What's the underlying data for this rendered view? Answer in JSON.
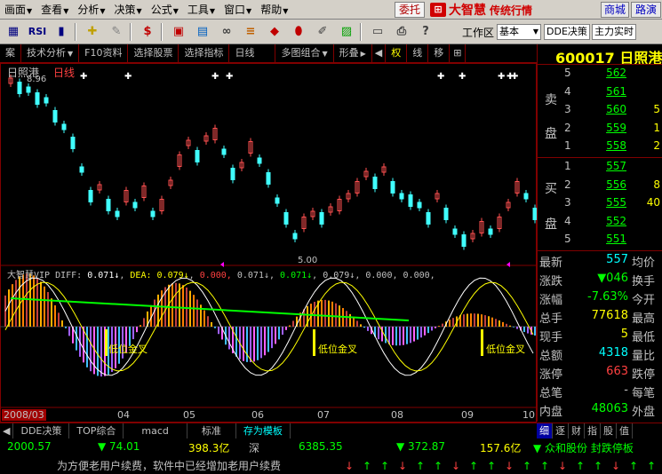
{
  "menu": [
    "画面",
    "查看",
    "分析",
    "决策",
    "公式",
    "工具",
    "窗口",
    "帮助"
  ],
  "weituo": "委托",
  "brand": {
    "name": "大智慧",
    "slogan": "传统行情"
  },
  "mall": "商城",
  "route": "路演",
  "toolbar": {
    "rsi": "RSI",
    "workzone_label": "工作区",
    "workzone_value": "基本",
    "combo_dde": "DDE决策",
    "combo_main": "主力实时"
  },
  "tabs": [
    "案",
    "技术分析",
    "F10资料",
    "选择股票",
    "选择指标",
    "日线",
    "多图组合",
    "形叠",
    "权",
    "线",
    "移"
  ],
  "chart": {
    "stock_name": "日照港",
    "period": "日线",
    "price_high": "8.96",
    "price_low": "5.00",
    "indicator": {
      "name": "大智慧VIP",
      "diff_label": "DIFF:",
      "diff_value": "0.071↓",
      "dea_label": "DEA:",
      "dea_value": "0.079↓",
      "v1": "0.000,",
      "v2": "0.071↓",
      "v3": "0.071↓",
      "v4": "0.079↓",
      "v5": "0.000,",
      "v6": "0.000,"
    },
    "gold_label": "低位金叉",
    "year": "2008/03",
    "months": [
      "04",
      "05",
      "06",
      "07",
      "08",
      "09",
      "10"
    ]
  },
  "quote": {
    "code": "600017",
    "name": "日照港",
    "sell_label_1": "卖",
    "sell_label_2": "盘",
    "buy_label_1": "买",
    "buy_label_2": "盘",
    "asks": [
      {
        "level": "5",
        "price": "562",
        "vol": ""
      },
      {
        "level": "4",
        "price": "561",
        "vol": ""
      },
      {
        "level": "3",
        "price": "560",
        "vol": "5"
      },
      {
        "level": "2",
        "price": "559",
        "vol": "1"
      },
      {
        "level": "1",
        "price": "558",
        "vol": "2"
      }
    ],
    "bids": [
      {
        "level": "1",
        "price": "557",
        "vol": ""
      },
      {
        "level": "2",
        "price": "556",
        "vol": "8"
      },
      {
        "level": "3",
        "price": "555",
        "vol": "40"
      },
      {
        "level": "4",
        "price": "552",
        "vol": ""
      },
      {
        "level": "5",
        "price": "551",
        "vol": ""
      }
    ],
    "stats": [
      {
        "label": "最新",
        "value": "557",
        "label2": "均价",
        "color": "#00ffff"
      },
      {
        "label": "涨跌",
        "value": "▼046",
        "label2": "换手",
        "color": "#00ff00"
      },
      {
        "label": "涨幅",
        "value": "-7.63%",
        "label2": "今开",
        "color": "#00ff00"
      },
      {
        "label": "总手",
        "value": "77618",
        "label2": "最高",
        "color": "#ffff00"
      },
      {
        "label": "现手",
        "value": "5",
        "label2": "最低",
        "color": "#ffff00"
      },
      {
        "label": "总额",
        "value": "4318",
        "label2": "量比",
        "color": "#00ffff"
      },
      {
        "label": "涨停",
        "value": "663",
        "label2": "跌停",
        "color": "#ff4040"
      },
      {
        "label": "总笔",
        "value": "-",
        "label2": "每笔",
        "color": "#c0c0c0"
      },
      {
        "label": "内盘",
        "value": "48063",
        "label2": "外盘",
        "color": "#00ff00"
      }
    ]
  },
  "bottom_tabs": [
    "DDE决策",
    "TOP综合",
    "macd",
    "标准",
    "存为模板"
  ],
  "right_tabs": [
    "细",
    "逐",
    "财",
    "指",
    "股",
    "值"
  ],
  "status": {
    "idx1": "2000.57",
    "chg1": "▼ 74.01",
    "amt1": "398.3亿",
    "mkt2": "深",
    "idx2": "6385.35",
    "chg2": "▼ 372.87",
    "amt2": "157.6亿",
    "news": "▼ 众和股份 封跌停板"
  },
  "ticker": "为方便老用户续费，软件中已经增加老用户续费"
}
